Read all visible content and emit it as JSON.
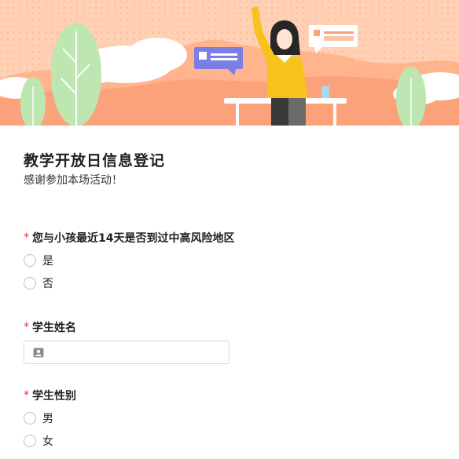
{
  "form": {
    "title": "教学开放日信息登记",
    "subtitle": "感谢参加本场活动！"
  },
  "questions": [
    {
      "required_mark": "*",
      "label": "您与小孩最近14天是否到过中高风险地区",
      "type": "radio",
      "options": [
        "是",
        "否"
      ]
    },
    {
      "required_mark": "*",
      "label": "学生姓名",
      "type": "text",
      "value": "",
      "icon": "contact-card-icon"
    },
    {
      "required_mark": "*",
      "label": "学生性别",
      "type": "radio",
      "options": [
        "男",
        "女"
      ]
    }
  ],
  "colors": {
    "banner_bg": "#ffc7a6",
    "accent_orange": "#fb9a6a",
    "required_red": "#e03131",
    "figure_yellow": "#f7c21c",
    "bubble_purple": "#7a7fe6",
    "tree_green": "#bde6b0"
  }
}
